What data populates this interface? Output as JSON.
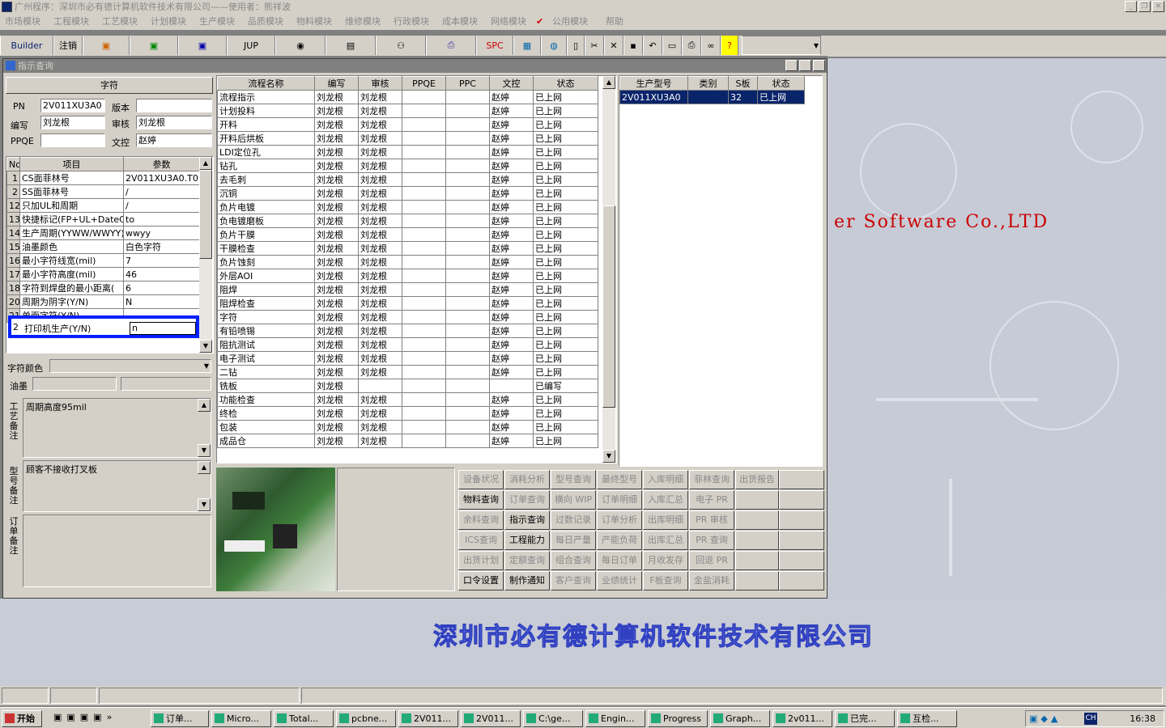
{
  "window": {
    "title": "广州程序：深圳市必有德计算机软件技术有限公司——使用者：熊祥波"
  },
  "menu": [
    "市场模块",
    "工程模块",
    "工艺模块",
    "计划模块",
    "生产模块",
    "品质模块",
    "物料模块",
    "维修模块",
    "行政模块",
    "成本模块",
    "网络模块",
    "公用模块",
    "帮助"
  ],
  "toolbar": {
    "builder": "Builder",
    "logout": "注销",
    "jup": "JUP",
    "spc": "SPC"
  },
  "child": {
    "title": "指示查询"
  },
  "left": {
    "section_title": "字符",
    "pn_label": "PN",
    "pn_value": "2V011XU3A0",
    "version_label": "版本",
    "version_value": "",
    "author_label": "编写",
    "author_value": "刘龙根",
    "review_label": "审核",
    "review_value": "刘龙根",
    "ppqe_label": "PPQE",
    "ppqe_value": "",
    "docctl_label": "文控",
    "docctl_value": "赵婷",
    "params_headers": [
      "No",
      "项目",
      "参数"
    ],
    "params": [
      {
        "no": "1",
        "item": "CS面菲林号",
        "val": "2V011XU3A0.T0"
      },
      {
        "no": "2",
        "item": "SS面菲林号",
        "val": "/"
      },
      {
        "no": "12",
        "item": "只加UL和周期",
        "val": "/"
      },
      {
        "no": "13",
        "item": "快捷标记(FP+UL+DateCo",
        "val": "to"
      },
      {
        "no": "14",
        "item": "生产周期(YYWW/WWYY)",
        "val": "wwyy"
      },
      {
        "no": "15",
        "item": "油墨颜色",
        "val": "白色字符"
      },
      {
        "no": "16",
        "item": "最小字符线宽(mil)",
        "val": "7"
      },
      {
        "no": "17",
        "item": "最小字符高度(mil)",
        "val": "46"
      },
      {
        "no": "18",
        "item": "字符到焊盘的最小距离(",
        "val": "6"
      },
      {
        "no": "20",
        "item": "周期为阴字(Y/N)",
        "val": "N"
      },
      {
        "no": "21",
        "item": "单面字符(Y/N)",
        "val": ""
      }
    ],
    "selected_row": {
      "no": "2",
      "item": "打印机生产(Y/N)",
      "val": "n"
    },
    "char_color_label": "字符颜色",
    "ink_label": "油墨",
    "craft_note_label": "工艺备注",
    "craft_note": "周期高度95mil",
    "model_note_label": "型号备注",
    "model_note": "顾客不接收打叉板",
    "order_note_label": "订单备注",
    "order_note": ""
  },
  "flow": {
    "headers": [
      "流程名称",
      "编写",
      "审核",
      "PPQE",
      "PPC",
      "文控",
      "状态"
    ],
    "rows": [
      [
        "流程指示",
        "刘龙根",
        "刘龙根",
        "",
        "",
        "赵婷",
        "已上网"
      ],
      [
        "计划投料",
        "刘龙根",
        "刘龙根",
        "",
        "",
        "赵婷",
        "已上网"
      ],
      [
        "开料",
        "刘龙根",
        "刘龙根",
        "",
        "",
        "赵婷",
        "已上网"
      ],
      [
        "开料后烘板",
        "刘龙根",
        "刘龙根",
        "",
        "",
        "赵婷",
        "已上网"
      ],
      [
        "LDI定位孔",
        "刘龙根",
        "刘龙根",
        "",
        "",
        "赵婷",
        "已上网"
      ],
      [
        "钻孔",
        "刘龙根",
        "刘龙根",
        "",
        "",
        "赵婷",
        "已上网"
      ],
      [
        "去毛刺",
        "刘龙根",
        "刘龙根",
        "",
        "",
        "赵婷",
        "已上网"
      ],
      [
        "沉铜",
        "刘龙根",
        "刘龙根",
        "",
        "",
        "赵婷",
        "已上网"
      ],
      [
        "负片电镀",
        "刘龙根",
        "刘龙根",
        "",
        "",
        "赵婷",
        "已上网"
      ],
      [
        "负电镀磨板",
        "刘龙根",
        "刘龙根",
        "",
        "",
        "赵婷",
        "已上网"
      ],
      [
        "负片干膜",
        "刘龙根",
        "刘龙根",
        "",
        "",
        "赵婷",
        "已上网"
      ],
      [
        "干膜检查",
        "刘龙根",
        "刘龙根",
        "",
        "",
        "赵婷",
        "已上网"
      ],
      [
        "负片蚀刻",
        "刘龙根",
        "刘龙根",
        "",
        "",
        "赵婷",
        "已上网"
      ],
      [
        "外层AOI",
        "刘龙根",
        "刘龙根",
        "",
        "",
        "赵婷",
        "已上网"
      ],
      [
        "阻焊",
        "刘龙根",
        "刘龙根",
        "",
        "",
        "赵婷",
        "已上网"
      ],
      [
        "阻焊检查",
        "刘龙根",
        "刘龙根",
        "",
        "",
        "赵婷",
        "已上网"
      ],
      [
        "字符",
        "刘龙根",
        "刘龙根",
        "",
        "",
        "赵婷",
        "已上网"
      ],
      [
        "有铅喷锡",
        "刘龙根",
        "刘龙根",
        "",
        "",
        "赵婷",
        "已上网"
      ],
      [
        "阻抗测试",
        "刘龙根",
        "刘龙根",
        "",
        "",
        "赵婷",
        "已上网"
      ],
      [
        "电子测试",
        "刘龙根",
        "刘龙根",
        "",
        "",
        "赵婷",
        "已上网"
      ],
      [
        "二钻",
        "刘龙根",
        "刘龙根",
        "",
        "",
        "赵婷",
        "已上网"
      ],
      [
        "铣板",
        "刘龙根",
        "",
        "",
        "",
        "",
        "已编写"
      ],
      [
        "功能检查",
        "刘龙根",
        "刘龙根",
        "",
        "",
        "赵婷",
        "已上网"
      ],
      [
        "终检",
        "刘龙根",
        "刘龙根",
        "",
        "",
        "赵婷",
        "已上网"
      ],
      [
        "包装",
        "刘龙根",
        "刘龙根",
        "",
        "",
        "赵婷",
        "已上网"
      ],
      [
        "成品仓",
        "刘龙根",
        "刘龙根",
        "",
        "",
        "赵婷",
        "已上网"
      ]
    ]
  },
  "models": {
    "headers": [
      "生产型号",
      "类别",
      "S板",
      "状态"
    ],
    "rows": [
      [
        "2V011XU3A0",
        "",
        "32",
        "已上网"
      ]
    ]
  },
  "buttons": [
    [
      "设备状况",
      "消耗分析",
      "型号查询",
      "最终型号",
      "入库明细",
      "菲林查询",
      "出货报告"
    ],
    [
      "物料查询",
      "订单查询",
      "横向 WIP",
      "订单明细",
      "入库汇总",
      "电子 PR",
      ""
    ],
    [
      "余料查询",
      "指示查询",
      "过数记录",
      "订单分析",
      "出库明细",
      "PR 审核",
      ""
    ],
    [
      "ICS查询",
      "工程能力",
      "每日产量",
      "产能负荷",
      "出库汇总",
      "PR 查询",
      ""
    ],
    [
      "出货计划",
      "定额查询",
      "组合查询",
      "每日订单",
      "月收发存",
      "回退 PR",
      ""
    ],
    [
      "口令设置",
      "制作通知",
      "客户查询",
      "业绩统计",
      "F板查询",
      "金盐消耗",
      ""
    ]
  ],
  "enabled_buttons": [
    "物料查询",
    "指示查询",
    "工程能力",
    "口令设置",
    "制作通知"
  ],
  "banner": "er Software Co.,LTD",
  "company": "深圳市必有德计算机软件技术有限公司",
  "taskbar": {
    "start": "开始",
    "tasks": [
      "订单...",
      "Micro...",
      "Total...",
      "pcbne...",
      "2V011...",
      "2V011...",
      "C:\\ge...",
      "Engin...",
      "Progress",
      "Graph...",
      "2v011...",
      "已完...",
      "互检..."
    ],
    "clock": "16:38",
    "tray_text": "CH"
  },
  "colors": {
    "accent": "#0a246a",
    "highlight": "#0000ff",
    "banner": "#cc0000"
  }
}
